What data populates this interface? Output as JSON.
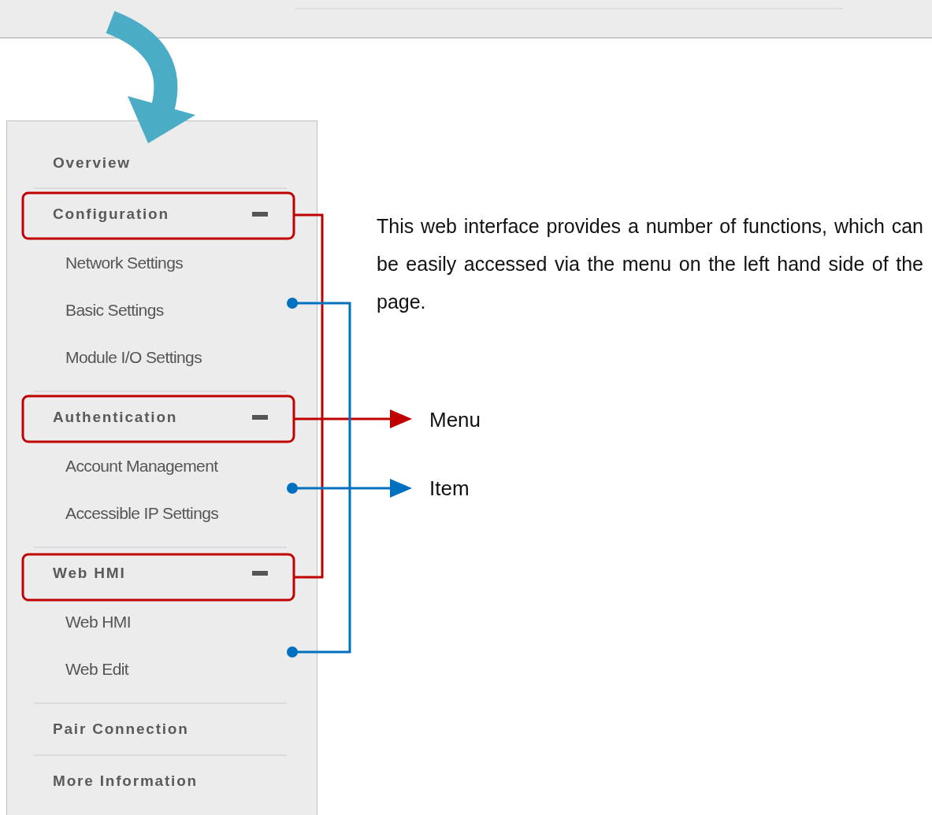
{
  "sidebar": {
    "items": [
      {
        "kind": "link",
        "label": "Overview"
      },
      {
        "kind": "group",
        "label": "Configuration",
        "expanded": true,
        "children": [
          {
            "label": "Network Settings"
          },
          {
            "label": "Basic Settings"
          },
          {
            "label": "Module I/O Settings"
          }
        ]
      },
      {
        "kind": "group",
        "label": "Authentication",
        "expanded": true,
        "children": [
          {
            "label": "Account Management"
          },
          {
            "label": "Accessible IP Settings"
          }
        ]
      },
      {
        "kind": "group",
        "label": "Web HMI",
        "expanded": true,
        "children": [
          {
            "label": "Web HMI"
          },
          {
            "label": "Web Edit"
          }
        ]
      },
      {
        "kind": "link",
        "label": "Pair Connection"
      },
      {
        "kind": "link",
        "label": "More Information"
      }
    ]
  },
  "annotation": {
    "description": "This web interface provides a number of functions, which can be easily accessed via the menu on the left hand side of the page.",
    "callouts": [
      {
        "kind": "menu",
        "label": "Menu"
      },
      {
        "kind": "item",
        "label": "Item"
      }
    ]
  }
}
